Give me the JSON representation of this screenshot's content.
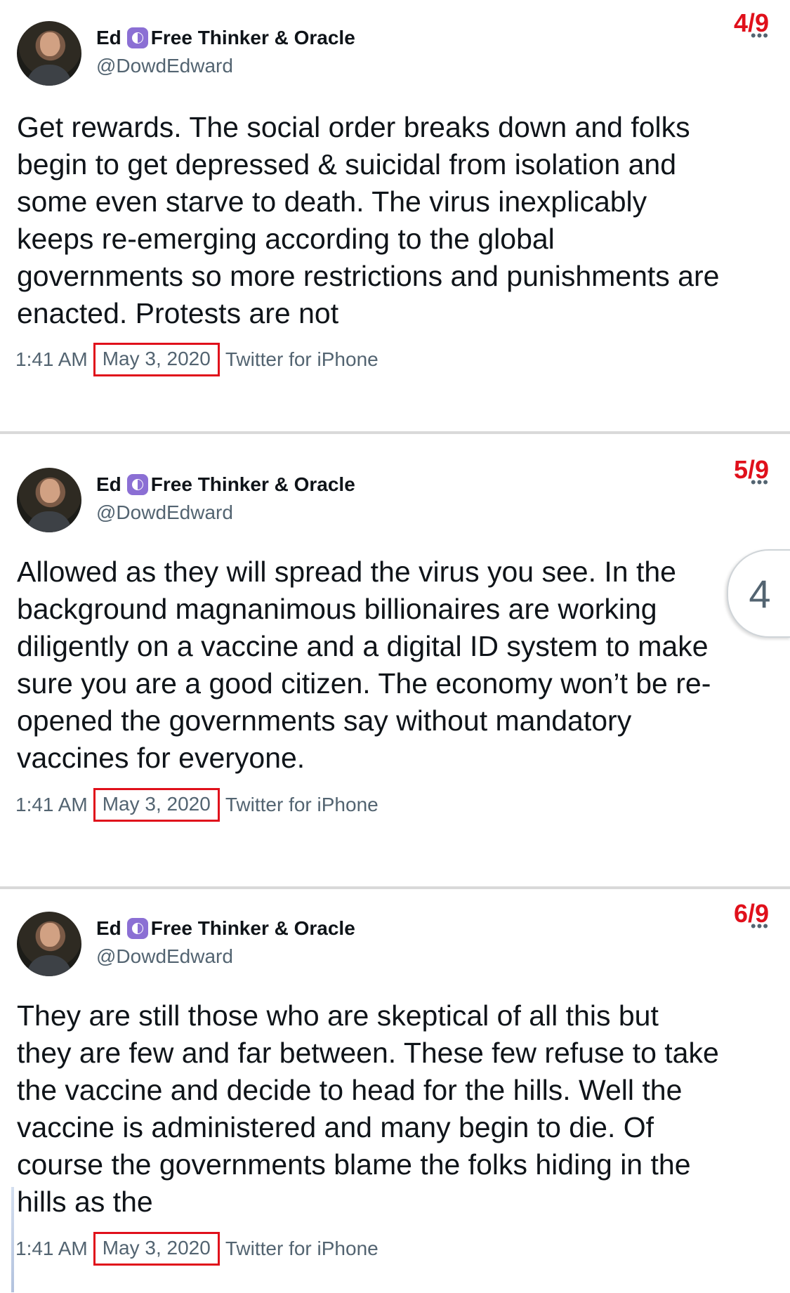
{
  "tweets": [
    {
      "display_name": "Ed",
      "display_name_suffix": "Free Thinker & Oracle",
      "handle": "@DowdEdward",
      "counter": "4/9",
      "text": "Get rewards. The social order breaks down and folks\nbegin to get depressed & suicidal from isolation and\nsome even starve to death. The virus inexplicably\nkeeps re-emerging according to the global\ngovernments so more restrictions and punishments are\nenacted. Protests are not",
      "time": "1:41 AM",
      "date": "May 3, 2020",
      "source": "Twitter for iPhone"
    },
    {
      "display_name": "Ed",
      "display_name_suffix": "Free Thinker & Oracle",
      "handle": "@DowdEdward",
      "counter": "5/9",
      "text": "Allowed as they will spread the virus you see. In the\nbackground magnanimous billionaires are working\ndiligently on a vaccine and a digital ID system to make\nsure you are a good citizen. The economy won’t be re-\nopened the governments say without mandatory\nvaccines for everyone.",
      "time": "1:41 AM",
      "date": "May 3, 2020",
      "source": "Twitter for iPhone"
    },
    {
      "display_name": "Ed",
      "display_name_suffix": "Free Thinker & Oracle",
      "handle": "@DowdEdward",
      "counter": "6/9",
      "text": "They are still those who are skeptical of all this but\nthey are few and far between. These few refuse to take\nthe vaccine and decide to head for the hills. Well the\nvaccine is administered and many begin to die. Of\ncourse the governments blame the folks hiding in the\nhills as the",
      "time": "1:41 AM",
      "date": "May 3, 2020",
      "source": "Twitter for iPhone"
    }
  ],
  "side_tab": {
    "label": "4"
  },
  "colors": {
    "highlight_red": "#e0101b",
    "badge_purple": "#8b6fd4",
    "meta_gray": "#536471"
  }
}
